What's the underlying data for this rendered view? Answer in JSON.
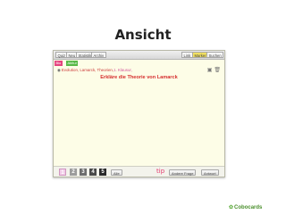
{
  "slide": {
    "title": "Ansicht"
  },
  "toolbar": {
    "items": [
      "Quiz",
      "Neu",
      "Statistik",
      "Archiv"
    ],
    "right_items": [
      "Link",
      "Marker",
      "Suchen"
    ]
  },
  "tabs": [
    "Bio",
    "Abitur"
  ],
  "breadcrumb": {
    "icon": "info-icon",
    "path": "Evolution, Lamarck, Theorien,",
    "tag": "1. Klausur,"
  },
  "card": {
    "question": "Erkläre die Theorie von Lamarck"
  },
  "bottom": {
    "numbers": [
      "1",
      "2",
      "3",
      "4",
      "5"
    ],
    "all_label": "Alle",
    "tip_label": "tip",
    "other_question_label": "Andere Frage",
    "answer_label": "Antwort"
  },
  "logo": {
    "text": "Cobocards"
  },
  "colors": {
    "accent": "#d62e2e",
    "tab_pink": "#e4437e",
    "tab_green": "#57b947",
    "marker": "#f0df63"
  }
}
